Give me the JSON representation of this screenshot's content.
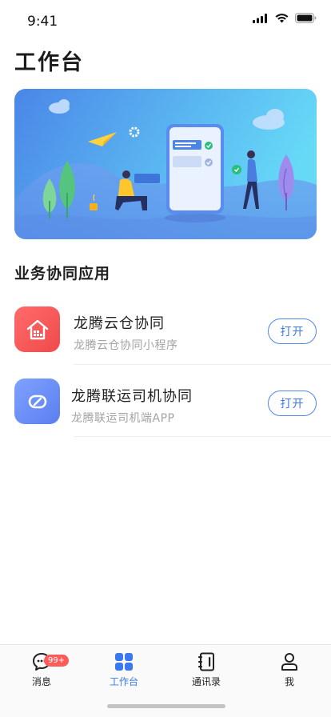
{
  "status_bar": {
    "time": "9:41"
  },
  "page": {
    "title": "工作台"
  },
  "section": {
    "title": "业务协同应用"
  },
  "apps": [
    {
      "name": "龙腾云仓协同",
      "desc": "龙腾云仓协同小程序",
      "button": "打开",
      "icon": "warehouse-house-icon",
      "color": "#f05252"
    },
    {
      "name": "龙腾联运司机协同",
      "desc": "龙腾联运司机端APP",
      "button": "打开",
      "icon": "link-chain-icon",
      "color": "#6488f3"
    }
  ],
  "tabs": [
    {
      "label": "消息",
      "icon": "chat-bubble-icon",
      "badge": "99+"
    },
    {
      "label": "工作台",
      "icon": "grid-apps-icon",
      "active": true
    },
    {
      "label": "通讯录",
      "icon": "contact-book-icon"
    },
    {
      "label": "我",
      "icon": "person-icon"
    }
  ],
  "colors": {
    "accent": "#3b78f0",
    "badge": "#ff5b5b",
    "banner_start": "#4a86e8",
    "banner_end": "#66d9f7"
  }
}
